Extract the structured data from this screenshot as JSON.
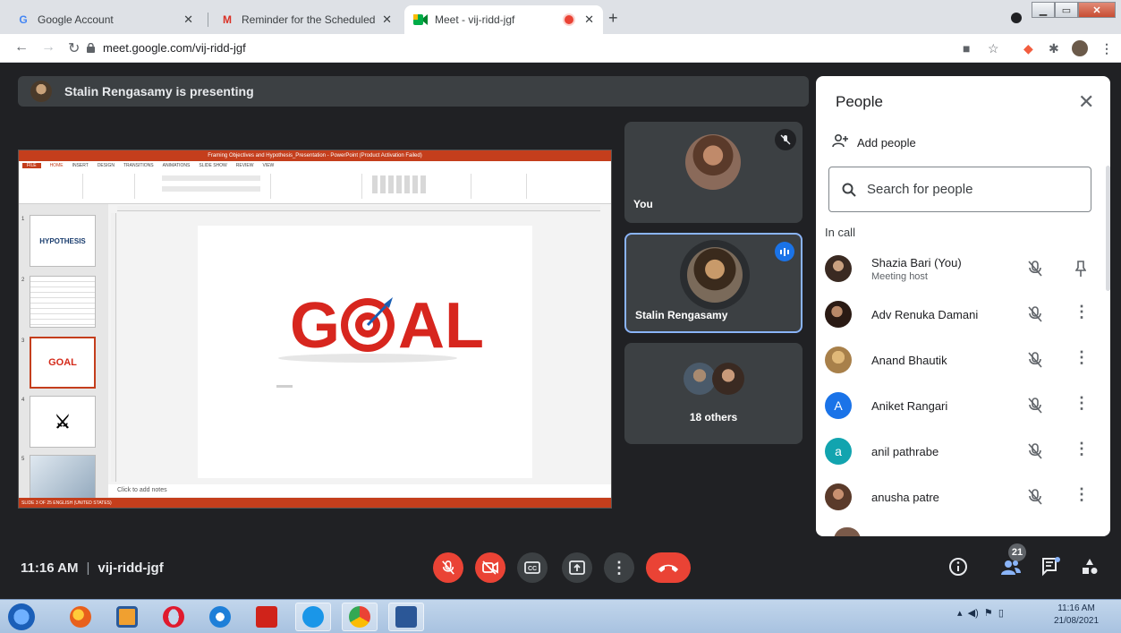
{
  "browser": {
    "tabs": [
      {
        "title": "Google Account",
        "favicon": "G"
      },
      {
        "title": "Reminder for the Scheduled Lect",
        "favicon": "M"
      },
      {
        "title": "Meet - vij-ridd-jgf",
        "favicon": "meet"
      }
    ],
    "url": "meet.google.com/vij-ridd-jgf"
  },
  "banner": {
    "text": "Stalin Rengasamy is presenting"
  },
  "slide": {
    "window_title": "Framing Objectives and Hypothesis_Presentation - PowerPoint (Product Activation Failed)",
    "menu": [
      "FILE",
      "HOME",
      "INSERT",
      "DESIGN",
      "TRANSITIONS",
      "ANIMATIONS",
      "SLIDE SHOW",
      "REVIEW",
      "VIEW"
    ],
    "thumb1": "HYPOTHESIS",
    "thumb3": "GOAL",
    "canvas_word": "GOAL",
    "notes": "Click to add notes",
    "status": "SLIDE 3 OF 25    ENGLISH (UNITED STATES)"
  },
  "tiles": {
    "you": "You",
    "stalin": "Stalin Rengasamy",
    "others": "18 others"
  },
  "people": {
    "title": "People",
    "add_people": "Add people",
    "search_placeholder": "Search for people",
    "section": "In call",
    "list": [
      {
        "name": "Shazia Bari (You)",
        "sub": "Meeting host",
        "initial": "",
        "color": "#6b4f3a"
      },
      {
        "name": "Adv Renuka Damani",
        "sub": "",
        "initial": "",
        "color": "#3a2a22"
      },
      {
        "name": "Anand Bhautik",
        "sub": "",
        "initial": "",
        "color": "#b98b4e"
      },
      {
        "name": "Aniket Rangari",
        "sub": "",
        "initial": "A",
        "color": "#1a73e8"
      },
      {
        "name": "anil pathrabe",
        "sub": "",
        "initial": "a",
        "color": "#12a4af"
      },
      {
        "name": "anusha patre",
        "sub": "",
        "initial": "",
        "color": "#7a4a3a"
      }
    ]
  },
  "bottom": {
    "time": "11:16 AM",
    "code": "vij-ridd-jgf",
    "participants_count": "21"
  },
  "taskbar": {
    "clock_time": "11:16 AM",
    "clock_date": "21/08/2021"
  }
}
